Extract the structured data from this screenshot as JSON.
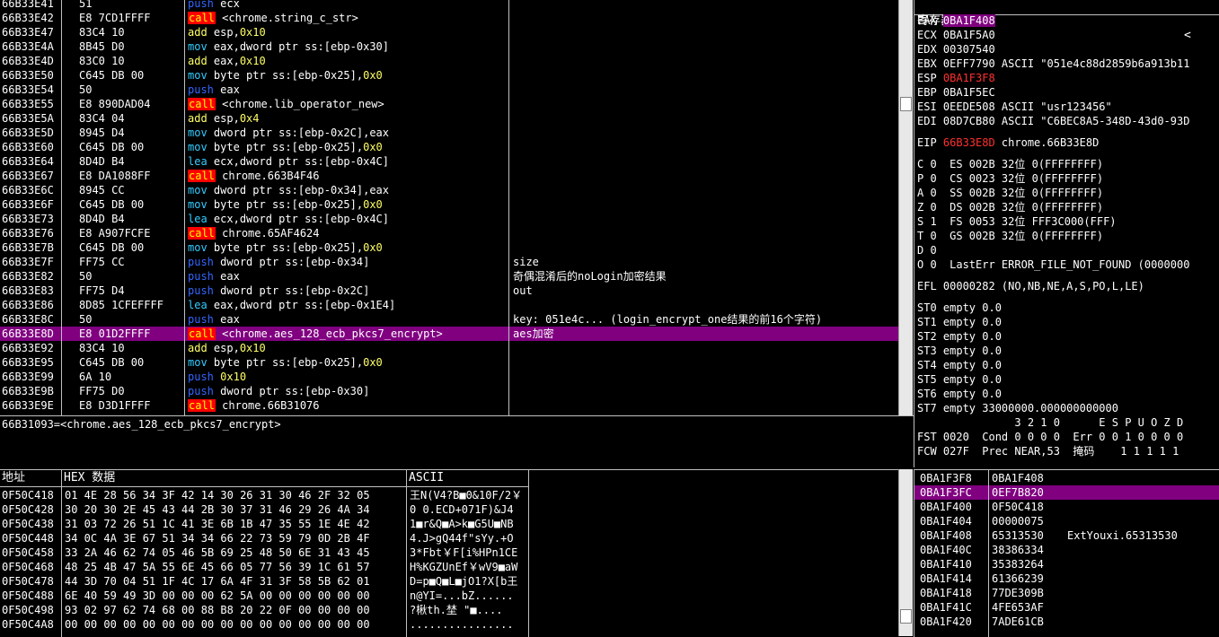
{
  "disasm": {
    "rows": [
      {
        "addr": "66B33E41",
        "hex": "51",
        "op": "push",
        "args": [
          [
            "w",
            "ecx"
          ]
        ],
        "comment": ""
      },
      {
        "addr": "66B33E42",
        "hex": "E8 7CD1FFFF",
        "op": "call",
        "args": [
          [
            "w",
            "<chrome.string_c_str>"
          ]
        ],
        "comment": ""
      },
      {
        "addr": "66B33E47",
        "hex": "83C4 10",
        "op": "add",
        "args": [
          [
            "w",
            "esp,"
          ],
          [
            "imm",
            "0x10"
          ]
        ],
        "comment": ""
      },
      {
        "addr": "66B33E4A",
        "hex": "8B45 D0",
        "op": "mov",
        "args": [
          [
            "w",
            "eax,dword ptr ss:[ebp-0x30]"
          ]
        ],
        "comment": ""
      },
      {
        "addr": "66B33E4D",
        "hex": "83C0 10",
        "op": "add",
        "args": [
          [
            "w",
            "eax,"
          ],
          [
            "imm",
            "0x10"
          ]
        ],
        "comment": ""
      },
      {
        "addr": "66B33E50",
        "hex": "C645 DB 00",
        "op": "mov",
        "args": [
          [
            "w",
            "byte ptr ss:[ebp-0x25],"
          ],
          [
            "imm",
            "0x0"
          ]
        ],
        "comment": ""
      },
      {
        "addr": "66B33E54",
        "hex": "50",
        "op": "push",
        "args": [
          [
            "w",
            "eax"
          ]
        ],
        "comment": ""
      },
      {
        "addr": "66B33E55",
        "hex": "E8 890DAD04",
        "op": "call",
        "args": [
          [
            "w",
            "<chrome.lib_operator_new>"
          ]
        ],
        "comment": ""
      },
      {
        "addr": "66B33E5A",
        "hex": "83C4 04",
        "op": "add",
        "args": [
          [
            "w",
            "esp,"
          ],
          [
            "imm",
            "0x4"
          ]
        ],
        "comment": ""
      },
      {
        "addr": "66B33E5D",
        "hex": "8945 D4",
        "op": "mov",
        "args": [
          [
            "w",
            "dword ptr ss:[ebp-0x2C],eax"
          ]
        ],
        "comment": ""
      },
      {
        "addr": "66B33E60",
        "hex": "C645 DB 00",
        "op": "mov",
        "args": [
          [
            "w",
            "byte ptr ss:[ebp-0x25],"
          ],
          [
            "imm",
            "0x0"
          ]
        ],
        "comment": ""
      },
      {
        "addr": "66B33E64",
        "hex": "8D4D B4",
        "op": "lea",
        "args": [
          [
            "w",
            "ecx,dword ptr ss:[ebp-0x4C]"
          ]
        ],
        "comment": ""
      },
      {
        "addr": "66B33E67",
        "hex": "E8 DA1088FF",
        "op": "call",
        "args": [
          [
            "w",
            "chrome.663B4F46"
          ]
        ],
        "comment": ""
      },
      {
        "addr": "66B33E6C",
        "hex": "8945 CC",
        "op": "mov",
        "args": [
          [
            "w",
            "dword ptr ss:[ebp-0x34],eax"
          ]
        ],
        "comment": ""
      },
      {
        "addr": "66B33E6F",
        "hex": "C645 DB 00",
        "op": "mov",
        "args": [
          [
            "w",
            "byte ptr ss:[ebp-0x25],"
          ],
          [
            "imm",
            "0x0"
          ]
        ],
        "comment": ""
      },
      {
        "addr": "66B33E73",
        "hex": "8D4D B4",
        "op": "lea",
        "args": [
          [
            "w",
            "ecx,dword ptr ss:[ebp-0x4C]"
          ]
        ],
        "comment": ""
      },
      {
        "addr": "66B33E76",
        "hex": "E8 A907FCFE",
        "op": "call",
        "args": [
          [
            "w",
            "chrome.65AF4624"
          ]
        ],
        "comment": ""
      },
      {
        "addr": "66B33E7B",
        "hex": "C645 DB 00",
        "op": "mov",
        "args": [
          [
            "w",
            "byte ptr ss:[ebp-0x25],"
          ],
          [
            "imm",
            "0x0"
          ]
        ],
        "comment": ""
      },
      {
        "addr": "66B33E7F",
        "hex": "FF75 CC",
        "op": "push",
        "args": [
          [
            "w",
            "dword ptr ss:[ebp-0x34]"
          ]
        ],
        "comment": "size"
      },
      {
        "addr": "66B33E82",
        "hex": "50",
        "op": "push",
        "args": [
          [
            "w",
            "eax"
          ]
        ],
        "comment": "奇偶混淆后的noLogin加密结果"
      },
      {
        "addr": "66B33E83",
        "hex": "FF75 D4",
        "op": "push",
        "args": [
          [
            "w",
            "dword ptr ss:[ebp-0x2C]"
          ]
        ],
        "comment": "out"
      },
      {
        "addr": "66B33E86",
        "hex": "8D85 1CFEFFFF",
        "op": "lea",
        "args": [
          [
            "w",
            "eax,dword ptr ss:[ebp-0x1E4]"
          ]
        ],
        "comment": ""
      },
      {
        "addr": "66B33E8C",
        "hex": "50",
        "op": "push",
        "args": [
          [
            "w",
            "eax"
          ]
        ],
        "comment": "key: 051e4c... (login_encrypt_one结果的前16个字符)"
      },
      {
        "addr": "66B33E8D",
        "hex": "E8 01D2FFFF",
        "op": "call",
        "args": [
          [
            "w",
            "<chrome.aes_128_ecb_pkcs7_encrypt>"
          ]
        ],
        "comment": "aes加密",
        "selected": true
      },
      {
        "addr": "66B33E92",
        "hex": "83C4 10",
        "op": "add",
        "args": [
          [
            "w",
            "esp,"
          ],
          [
            "imm",
            "0x10"
          ]
        ],
        "comment": ""
      },
      {
        "addr": "66B33E95",
        "hex": "C645 DB 00",
        "op": "mov",
        "args": [
          [
            "w",
            "byte ptr ss:[ebp-0x25],"
          ],
          [
            "imm",
            "0x0"
          ]
        ],
        "comment": ""
      },
      {
        "addr": "66B33E99",
        "hex": "6A 10",
        "op": "push",
        "args": [
          [
            "imm",
            "0x10"
          ]
        ],
        "comment": ""
      },
      {
        "addr": "66B33E9B",
        "hex": "FF75 D0",
        "op": "push",
        "args": [
          [
            "w",
            "dword ptr ss:[ebp-0x30]"
          ]
        ],
        "comment": ""
      },
      {
        "addr": "66B33E9E",
        "hex": "E8 D3D1FFFF",
        "op": "call",
        "args": [
          [
            "w",
            "chrome.66B31076"
          ]
        ],
        "comment": ""
      }
    ]
  },
  "info_line": "66B31093=<chrome.aes_128_ecb_pkcs7_encrypt>",
  "registers": {
    "title": "寄存器 (FPU)",
    "collapse": "<",
    "gp": [
      {
        "name": "EAX",
        "value": "0BA1F408",
        "extra": "",
        "style": "hl"
      },
      {
        "name": "ECX",
        "value": "0BA1F5A0",
        "extra": "",
        "style": ""
      },
      {
        "name": "EDX",
        "value": "00307540",
        "extra": "",
        "style": ""
      },
      {
        "name": "EBX",
        "value": "0EFF7790",
        "extra": "ASCII \"051e4c88d2859b6a913b11",
        "style": ""
      },
      {
        "name": "ESP",
        "value": "0BA1F3F8",
        "extra": "",
        "style": "red"
      },
      {
        "name": "EBP",
        "value": "0BA1F5EC",
        "extra": "",
        "style": ""
      },
      {
        "name": "ESI",
        "value": "0EEDE508",
        "extra": "ASCII \"usr123456\"",
        "style": ""
      },
      {
        "name": "EDI",
        "value": "08D7CB80",
        "extra": "ASCII \"C6BEC8A5-348D-43d0-93D",
        "style": ""
      }
    ],
    "eip": {
      "name": "EIP",
      "value": "66B33E8D",
      "extra": "chrome.66B33E8D"
    },
    "flags": [
      "C 0  ES 002B 32位 0(FFFFFFFF)",
      "P 0  CS 0023 32位 0(FFFFFFFF)",
      "A 0  SS 002B 32位 0(FFFFFFFF)",
      "Z 0  DS 002B 32位 0(FFFFFFFF)",
      "S 1  FS 0053 32位 FFF3C000(FFF)",
      "T 0  GS 002B 32位 0(FFFFFFFF)",
      "D 0",
      "O 0  LastErr ERROR_FILE_NOT_FOUND (0000000"
    ],
    "efl": "EFL 00000282 (NO,NB,NE,A,S,PO,L,LE)",
    "fpu": [
      "ST0 empty 0.0",
      "ST1 empty 0.0",
      "ST2 empty 0.0",
      "ST3 empty 0.0",
      "ST4 empty 0.0",
      "ST5 empty 0.0",
      "ST6 empty 0.0",
      "ST7 empty 33000000.000000000000"
    ],
    "fpu_bits_header": "               3 2 1 0      E S P U O Z D",
    "fst": "FST 0020  Cond 0 0 0 0  Err 0 0 1 0 0 0 0",
    "fcw": "FCW 027F  Prec NEAR,53  掩码    1 1 1 1 1"
  },
  "dump": {
    "headers": {
      "addr": "地址",
      "hex": "HEX 数据",
      "ascii": "ASCII"
    },
    "rows": [
      {
        "addr": "0F50C418",
        "hex": "01 4E 28 56 34 3F 42 14 30 26 31 30 46 2F 32 05",
        "ascii": "王N(V4?B■0&10F/2￥"
      },
      {
        "addr": "0F50C428",
        "hex": "30 20 30 2E 45 43 44 2B 30 37 31 46 29 26 4A 34",
        "ascii": "0 0.ECD+071F)&J4"
      },
      {
        "addr": "0F50C438",
        "hex": "31 03 72 26 51 1C 41 3E 6B 1B 47 35 55 1E 4E 42",
        "ascii": "1■r&Q■A>k■G5U■NB"
      },
      {
        "addr": "0F50C448",
        "hex": "34 0C 4A 3E 67 51 34 34 66 22 73 59 79 0D 2B 4F",
        "ascii": "4.J>gQ44f\"sYy.+O"
      },
      {
        "addr": "0F50C458",
        "hex": "33 2A 46 62 74 05 46 5B 69 25 48 50 6E 31 43 45",
        "ascii": "3*Fbt￥F[i%HPn1CE"
      },
      {
        "addr": "0F50C468",
        "hex": "48 25 4B 47 5A 55 6E 45 66 05 77 56 39 1C 61 57",
        "ascii": "H%KGZUnEf￥wV9■aW"
      },
      {
        "addr": "0F50C478",
        "hex": "44 3D 70 04 51 1F 4C 17 6A 4F 31 3F 58 5B 62 01",
        "ascii": "D=p■Q■L■jO1?X[b王"
      },
      {
        "addr": "0F50C488",
        "hex": "6E 40 59 49 3D 00 00 00 62 5A 00 00 00 00 00 00",
        "ascii": "n@YI=...bZ......"
      },
      {
        "addr": "0F50C498",
        "hex": "93 02 97 62 74 68 00 88 B8 20 22 0F 00 00 00 00",
        "ascii": "?楸th.埜 \"■...."
      },
      {
        "addr": "0F50C4A8",
        "hex": "00 00 00 00 00 00 00 00 00 00 00 00 00 00 00 00",
        "ascii": "................"
      }
    ]
  },
  "stack": {
    "rows": [
      {
        "addr": "0BA1F3F8",
        "value": "0BA1F408",
        "comment": ""
      },
      {
        "addr": "0BA1F3FC",
        "value": "0EF7B820",
        "comment": "",
        "selected": true
      },
      {
        "addr": "0BA1F400",
        "value": "0F50C418",
        "comment": ""
      },
      {
        "addr": "0BA1F404",
        "value": "00000075",
        "comment": ""
      },
      {
        "addr": "0BA1F408",
        "value": "65313530",
        "comment": "ExtYouxi.65313530"
      },
      {
        "addr": "0BA1F40C",
        "value": "38386334",
        "comment": ""
      },
      {
        "addr": "0BA1F410",
        "value": "35383264",
        "comment": ""
      },
      {
        "addr": "0BA1F414",
        "value": "61366239",
        "comment": ""
      },
      {
        "addr": "0BA1F418",
        "value": "77DE309B",
        "comment": ""
      },
      {
        "addr": "0BA1F41C",
        "value": "4FE653AF",
        "comment": ""
      },
      {
        "addr": "0BA1F420",
        "value": "7ADE61CB",
        "comment": ""
      }
    ]
  }
}
